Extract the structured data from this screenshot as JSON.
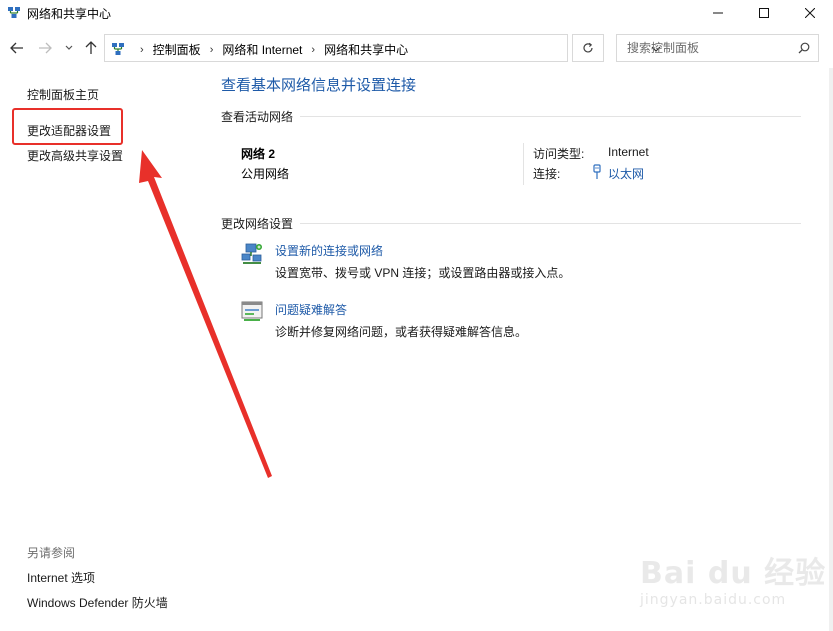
{
  "window": {
    "title": "网络和共享中心",
    "controls": {
      "minimize": "—",
      "maximize": "☐",
      "close": "✕"
    }
  },
  "nav": {
    "back_icon": "arrow-left-icon",
    "forward_icon": "arrow-right-icon",
    "recent_icon": "chevron-down-icon",
    "up_icon": "arrow-up-icon"
  },
  "address": {
    "crumbs": [
      "控制面板",
      "网络和 Internet",
      "网络和共享中心"
    ],
    "separator": "›"
  },
  "search": {
    "placeholder": "搜索控制面板"
  },
  "sidebar": {
    "items": [
      {
        "label": "控制面板主页"
      },
      {
        "label": "更改适配器设置"
      },
      {
        "label": "更改高级共享设置"
      }
    ],
    "see_also_title": "另请参阅",
    "see_also": [
      {
        "label": "Internet 选项"
      },
      {
        "label": "Windows Defender 防火墙"
      }
    ]
  },
  "main": {
    "title": "查看基本网络信息并设置连接",
    "active_section": "查看活动网络",
    "network": {
      "name": "网络 2",
      "profile": "公用网络",
      "access_type_label": "访问类型:",
      "access_type_value": "Internet",
      "connection_label": "连接:",
      "connection_value": "以太网"
    },
    "change_section": "更改网络设置",
    "tasks": [
      {
        "title": "设置新的连接或网络",
        "desc": "设置宽带、拨号或 VPN 连接；或设置路由器或接入点。",
        "icon": "new-connection-icon"
      },
      {
        "title": "问题疑难解答",
        "desc": "诊断并修复网络问题，或者获得疑难解答信息。",
        "icon": "troubleshoot-icon"
      }
    ]
  },
  "annotation": {
    "color": "#e8302a"
  },
  "watermark": {
    "text": "Bai du 经验",
    "sub": "jingyan.baidu.com"
  },
  "colors": {
    "link": "#1e5aa8",
    "title": "#1e5aa8",
    "highlight": "#e8302a"
  }
}
